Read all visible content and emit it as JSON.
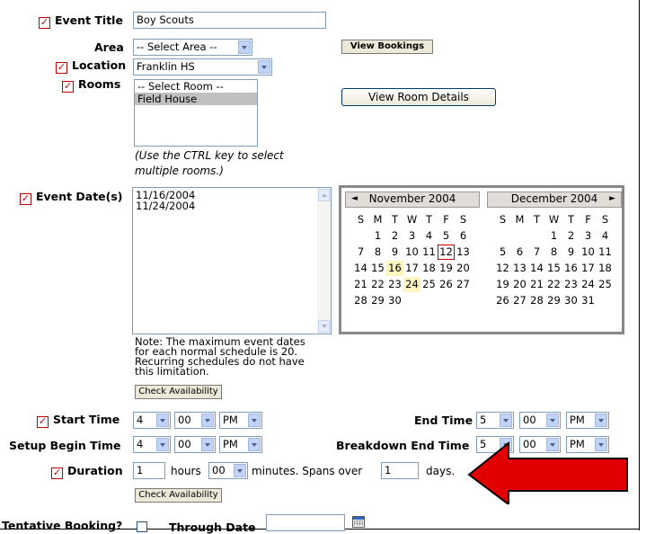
{
  "event_title": {
    "label": "Event Title",
    "value": "Boy Scouts"
  },
  "area": {
    "label": "Area",
    "selected": "-- Select Area --"
  },
  "view_bookings_button": "View Bookings",
  "location": {
    "label": "Location",
    "selected": "Franklin HS"
  },
  "rooms": {
    "label": "Rooms",
    "options": [
      "-- Select Room --",
      "Field House"
    ],
    "selected": "Field House",
    "note_line1": "(Use the CTRL key to select",
    "note_line2": "multiple rooms.)"
  },
  "view_room_details_button": "View Room Details",
  "event_dates": {
    "label": "Event Date(s)",
    "values": [
      "11/16/2004",
      "11/24/2004"
    ],
    "note_lines": [
      "Note: The maximum event dates",
      "for each normal schedule is 20.",
      "Recurring schedules do not have",
      "this limitation."
    ],
    "check_button": "Check Availability"
  },
  "calendar": {
    "weekday_headers": [
      "S",
      "M",
      "T",
      "W",
      "T",
      "F",
      "S"
    ],
    "months": [
      {
        "title": "November 2004",
        "leading_blanks": 1,
        "days": 30,
        "today": 12,
        "highlighted": [
          16,
          24
        ]
      },
      {
        "title": "December 2004",
        "leading_blanks": 3,
        "days": 31,
        "today": null,
        "highlighted": []
      }
    ]
  },
  "start_time": {
    "label": "Start Time",
    "hour": "4",
    "minute": "00",
    "ampm": "PM"
  },
  "end_time": {
    "label": "End Time",
    "hour": "5",
    "minute": "00",
    "ampm": "PM"
  },
  "setup_begin_time": {
    "label": "Setup Begin Time",
    "hour": "4",
    "minute": "00",
    "ampm": "PM"
  },
  "breakdown_end_time": {
    "label": "Breakdown End Time",
    "hour": "5",
    "minute": "00",
    "ampm": "PM"
  },
  "duration": {
    "label": "Duration",
    "hours": "1",
    "hours_text": "hours",
    "minutes": "00",
    "minutes_text": "minutes. Spans over",
    "days": "1",
    "days_text": "days.",
    "check_button": "Check Availability"
  },
  "tentative": {
    "label": "Tentative Booking?",
    "through_label": "Through Date"
  },
  "colors": {
    "accent_red": "#e00000",
    "checkmark": "#c00000",
    "input_border": "#7f9db9"
  }
}
